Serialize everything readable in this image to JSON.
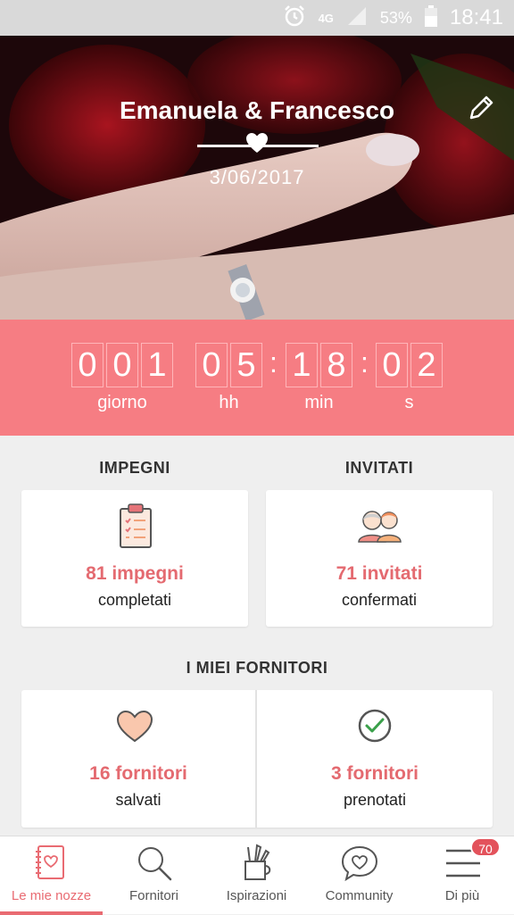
{
  "status_bar": {
    "network": "4G",
    "battery": "53%",
    "time": "18:41"
  },
  "hero": {
    "couple": "Emanuela & Francesco",
    "date": "3/06/2017"
  },
  "countdown": {
    "days": [
      "0",
      "0",
      "1"
    ],
    "hours": [
      "0",
      "5"
    ],
    "minutes": [
      "1",
      "8"
    ],
    "seconds": [
      "0",
      "2"
    ],
    "labels": {
      "days": "giorno",
      "hours": "hh",
      "minutes": "min",
      "seconds": "s"
    }
  },
  "sections": {
    "tasks_title": "IMPEGNI",
    "guests_title": "INVITATI",
    "vendors_title": "I MIEI FORNITORI"
  },
  "cards": {
    "tasks": {
      "value": "81 impegni",
      "sub": "completati"
    },
    "guests": {
      "value": "71 invitati",
      "sub": "confermati"
    },
    "saved_vendors": {
      "value": "16 fornitori",
      "sub": "salvati"
    },
    "booked_vendors": {
      "value": "3 fornitori",
      "sub": "prenotati"
    }
  },
  "tabs": [
    {
      "label": "Le mie nozze",
      "icon": "notebook-icon"
    },
    {
      "label": "Fornitori",
      "icon": "search-icon"
    },
    {
      "label": "Ispirazioni",
      "icon": "brush-cup-icon"
    },
    {
      "label": "Community",
      "icon": "chat-heart-icon"
    },
    {
      "label": "Di più",
      "icon": "menu-icon"
    }
  ],
  "badge": "70",
  "colors": {
    "accent": "#e96b72",
    "countdown_bg": "#f67d83",
    "value_text": "#e46a70"
  }
}
